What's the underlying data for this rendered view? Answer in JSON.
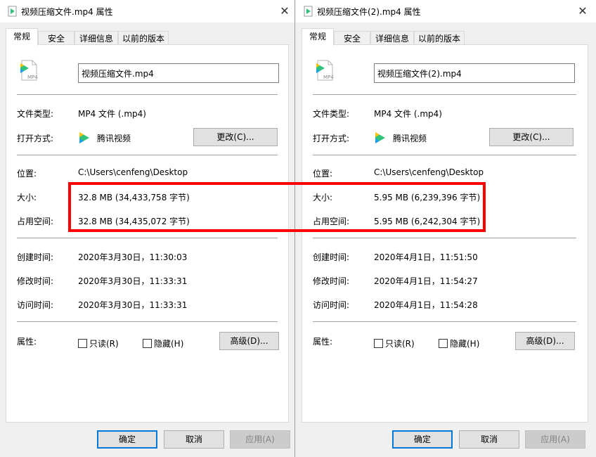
{
  "dialogs": [
    {
      "title": "视频压缩文件.mp4 属性",
      "tabs": [
        "常规",
        "安全",
        "详细信息",
        "以前的版本"
      ],
      "file_icon_text": "MP4",
      "filename": "视频压缩文件.mp4",
      "file_type_label": "文件类型:",
      "file_type": "MP4 文件 (.mp4)",
      "opens_with_label": "打开方式:",
      "opens_with": "腾讯视频",
      "change_button": "更改(C)...",
      "location_label": "位置:",
      "location": "C:\\Users\\cenfeng\\Desktop",
      "size_label": "大小:",
      "size": "32.8 MB (34,433,758 字节)",
      "size_on_disk_label": "占用空间:",
      "size_on_disk": "32.8 MB (34,435,072 字节)",
      "created_label": "创建时间:",
      "created": "2020年3月30日，11:30:03",
      "modified_label": "修改时间:",
      "modified": "2020年3月30日，11:33:31",
      "accessed_label": "访问时间:",
      "accessed": "2020年3月30日，11:33:31",
      "attributes_label": "属性:",
      "readonly_label": "只读(R)",
      "hidden_label": "隐藏(H)",
      "advanced_button": "高级(D)...",
      "ok_button": "确定",
      "cancel_button": "取消",
      "apply_button": "应用(A)"
    },
    {
      "title": "视频压缩文件(2).mp4 属性",
      "tabs": [
        "常规",
        "安全",
        "详细信息",
        "以前的版本"
      ],
      "file_icon_text": "MP4",
      "filename": "视频压缩文件(2).mp4",
      "file_type_label": "文件类型:",
      "file_type": "MP4 文件 (.mp4)",
      "opens_with_label": "打开方式:",
      "opens_with": "腾讯视频",
      "change_button": "更改(C)...",
      "location_label": "位置:",
      "location": "C:\\Users\\cenfeng\\Desktop",
      "size_label": "大小:",
      "size": "5.95 MB (6,239,396 字节)",
      "size_on_disk_label": "占用空间:",
      "size_on_disk": "5.95 MB (6,242,304 字节)",
      "created_label": "创建时间:",
      "created": "2020年4月1日，11:51:50",
      "modified_label": "修改时间:",
      "modified": "2020年4月1日，11:54:27",
      "accessed_label": "访问时间:",
      "accessed": "2020年4月1日，11:54:28",
      "attributes_label": "属性:",
      "readonly_label": "只读(R)",
      "hidden_label": "隐藏(H)",
      "advanced_button": "高级(D)...",
      "ok_button": "确定",
      "cancel_button": "取消",
      "apply_button": "应用(A)"
    }
  ],
  "colors": {
    "highlight": "#ff0000",
    "primary_border": "#0078d7",
    "tencent_green": "#31c27c",
    "tencent_blue": "#1f9ff2",
    "tencent_yellow": "#ffc300"
  },
  "icons": {
    "title_icon": "video-file-icon",
    "close": "close-icon",
    "app": "tencent-video-icon"
  }
}
